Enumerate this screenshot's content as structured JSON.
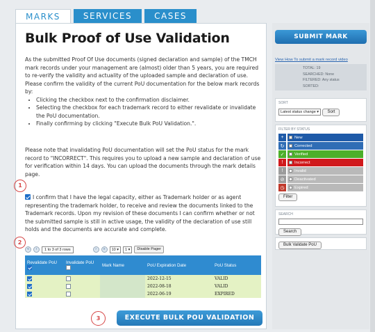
{
  "tabs": [
    {
      "label": "MARKS",
      "active": true
    },
    {
      "label": "SERVICES",
      "active": false
    },
    {
      "label": "CASES",
      "active": false
    }
  ],
  "page_title": "Bulk Proof of Use Validation",
  "intro": {
    "p1": "As the submitted Proof Of Use documents (signed declaration and sample) of the TMCH mark records under your management are (almost) older than 5 years, you are required to re-verify the validity and actuality of the uploaded sample and declaration of use.",
    "p2": "Please confirm the validity of the current PoU documentation for the below mark records by:",
    "bullets": [
      "Clicking the checkbox next to the confirmation disclaimer.",
      "Selecting the checkbox for each trademark record to either revalidate or invalidate the PoU documentation.",
      "Finally confirming by clicking \"Execute Bulk PoU Validation.\"."
    ],
    "p3": "Please note that invalidating PoU documentation will set the PoU status for the mark record to \"INCORRECT\". This requires you to upload a new sample and declaration of use for verification within 14 days. You can upload the documents through the mark details page."
  },
  "confirmation_text": "I confirm that I have the legal capacity, either as Trademark holder or as agent representing the trademark holder, to receive and review the documents linked to the Trademark records. Upon my revision of these documents I can confirm whether or not the submitted sample is still in active usage, the validity of the declaration of use still holds and the documents are accurate and complete.",
  "pager": {
    "range_text": "1 to 3 of 3 rows",
    "page_size": "10",
    "page_num": "1",
    "disable_label": "Disable Pager"
  },
  "table": {
    "headers": [
      "Revalidate PoU",
      "Invalidate PoU",
      "Mark Name",
      "PoU Expiration Date",
      "PoU Status"
    ],
    "rows": [
      {
        "revalidate": true,
        "invalidate": false,
        "mark_name": "",
        "expiration": "2022-12-15",
        "status": "VALID"
      },
      {
        "revalidate": true,
        "invalidate": false,
        "mark_name": "",
        "expiration": "2022-08-18",
        "status": "VALID"
      },
      {
        "revalidate": true,
        "invalidate": false,
        "mark_name": "",
        "expiration": "2022-06-19",
        "status": "EXPIRED"
      }
    ]
  },
  "execute_button": "EXECUTE BULK POU VALIDATION",
  "markers": [
    "1",
    "2",
    "3"
  ],
  "sidebar": {
    "submit_label": "SUBMIT MARK",
    "how_to_link": "View How To submit a mark record video",
    "stats": [
      {
        "label": "TOTAL:",
        "value": "19"
      },
      {
        "label": "SEARCHED:",
        "value": "None"
      },
      {
        "label": "FILTERED:",
        "value": "Any status"
      },
      {
        "label": "SORTED:",
        "value": ""
      }
    ],
    "sort": {
      "heading": "SORT",
      "selected": "Latest status change",
      "button": "Sort"
    },
    "filter": {
      "heading": "FILTER BY STATUS",
      "items": [
        {
          "label": "New",
          "color": "#1e5aa8",
          "icon_color": "#1e5aa8",
          "icon": "plus-icon"
        },
        {
          "label": "Corrected",
          "color": "#2f6db5",
          "icon_color": "#2f6db5",
          "icon": "refresh-icon"
        },
        {
          "label": "Verified",
          "color": "#4caf2a",
          "icon_color": "#4caf2a",
          "icon": "check-icon"
        },
        {
          "label": "Incorrect",
          "color": "#d0191c",
          "icon_color": "#d0191c",
          "icon": "warning-icon"
        },
        {
          "label": "Invalid",
          "color": "#b9b9b9",
          "icon_color": "#9c9c9c",
          "icon": "warning-icon"
        },
        {
          "label": "Deactivated",
          "color": "#b9b9b9",
          "icon_color": "#9c9c9c",
          "icon": "slash-icon"
        },
        {
          "label": "Expired",
          "color": "#b9b9b9",
          "icon_color": "#c0392b",
          "icon": "clock-icon"
        }
      ],
      "button": "Filter"
    },
    "search": {
      "heading": "SEARCH",
      "placeholder": "",
      "button": "Search"
    },
    "bulk_button": "Bulk Validate PoU"
  }
}
